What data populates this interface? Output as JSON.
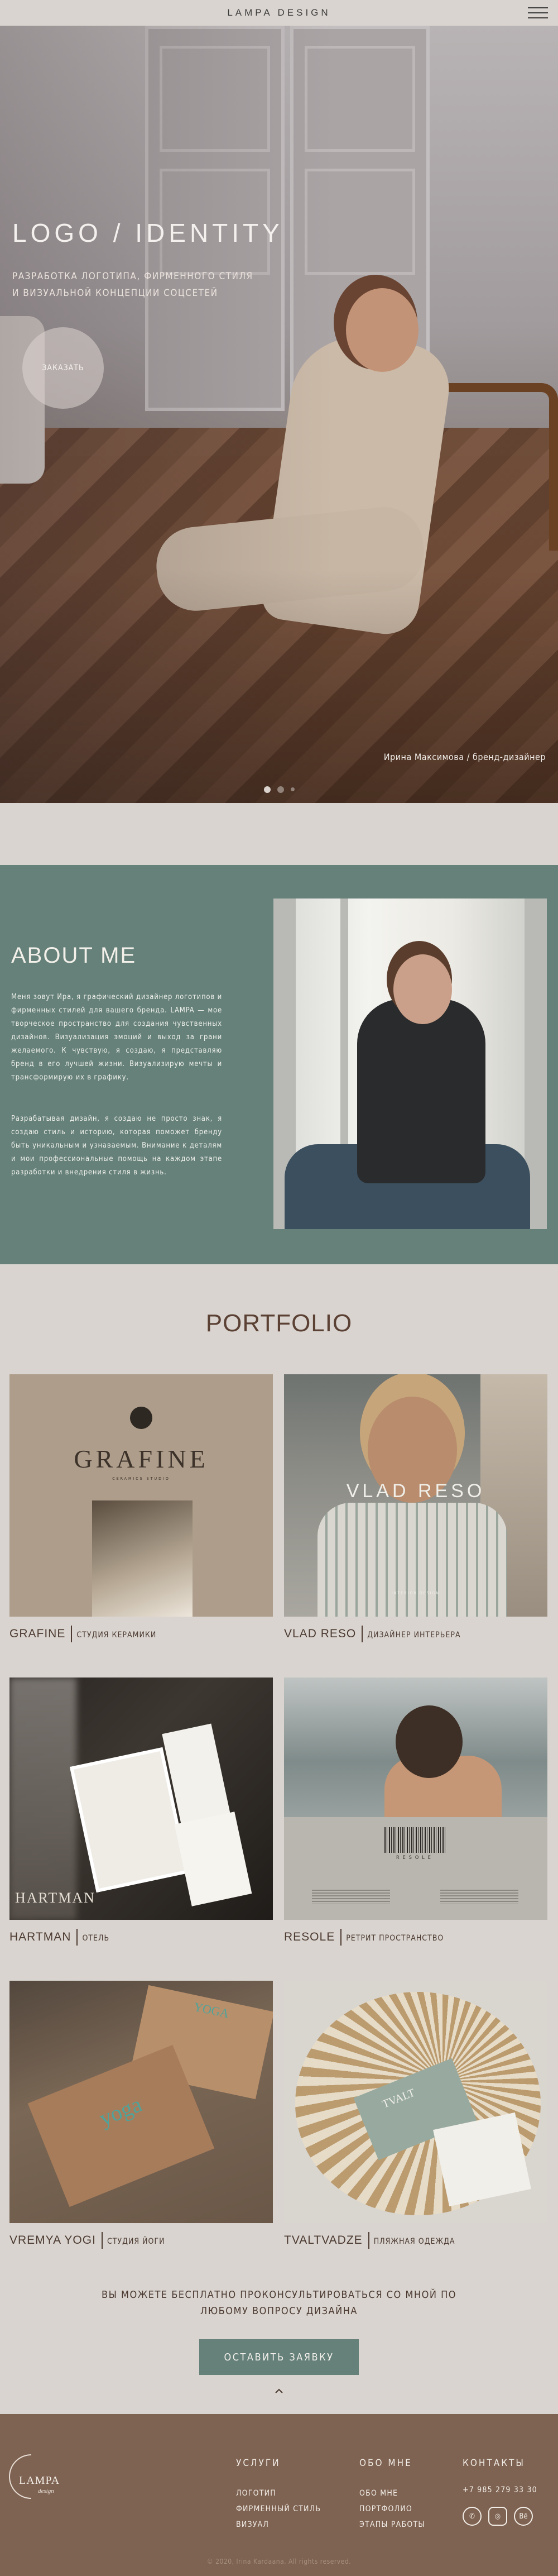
{
  "header": {
    "brand": "LAMPA DESIGN",
    "menu_icon": "burger-menu-icon"
  },
  "hero": {
    "title": "LOGO / IDENTITY",
    "subtitle_line1": "РАЗРАБОТКА ЛОГОТИПА, ФИРМЕННОГО СТИЛЯ",
    "subtitle_line2": "И ВИЗУАЛЬНОЙ КОНЦЕПЦИИ СОЦСЕТЕЙ",
    "cta": "ЗАКАЗАТЬ",
    "caption": "Ирина Максимова / бренд-дизайнер",
    "slides_total": 3,
    "slide_active": 1
  },
  "about": {
    "title": "ABOUT ME",
    "paragraph1": "Меня зовут Ира, я графический дизайнер логотипов и фирменных стилей для вашего бренда. LAMPA — мое творческое пространство для создания чувственных дизайнов. Визуализация эмоций и выход за грани желаемого. К чувствую, я создаю, я представляю бренд в его лучшей жизни. Визуализирую мечты и трансформирую их в графику.",
    "paragraph2": "Разрабатывая дизайн, я создаю не просто знак, я создаю стиль и историю, которая поможет бренду быть уникальным и узнаваемым. Внимание к деталям и мои профессиональные помощь на каждом этапе разработки и внедрения стиля в жизнь."
  },
  "portfolio": {
    "title": "PORTFOLIO",
    "items": [
      {
        "name": "GRAFINE",
        "desc": "СТУДИЯ КЕРАМИКИ",
        "img_text": "GRAFINE",
        "img_sub": "CERAMICS STUDIO"
      },
      {
        "name": "VLAD RESO",
        "desc": "ДИЗАЙНЕР ИНТЕРЬЕРА",
        "img_text": "VLAD RESO",
        "img_sub": "INTERIOR DESIGN"
      },
      {
        "name": "HARTMAN",
        "desc": "ОТЕЛЬ",
        "img_text": "HARTMAN"
      },
      {
        "name": "RESOLE",
        "desc": "РЕТРИТ ПРОСТРАНСТВО",
        "img_text": "RESOLE"
      },
      {
        "name": "VREMYA YOGI",
        "desc": "СТУДИЯ ЙОГИ",
        "img_text": "yoga",
        "img_sub": "YOGA"
      },
      {
        "name": "TVALTVADZE",
        "desc": "ПЛЯЖНАЯ ОДЕЖДА",
        "img_text": "TVALT"
      }
    ]
  },
  "consult": {
    "line1": "ВЫ МОЖЕТЕ БЕСПЛАТНО ПРОКОНСУЛЬТИРОВАТЬСЯ СО МНОЙ ПО",
    "line2": "ЛЮБОМУ ВОПРОСУ ДИЗАЙНА",
    "button": "ОСТАВИТЬ ЗАЯВКУ",
    "up_icon": "chevron-up-icon"
  },
  "footer": {
    "logo_text": "LAMPA",
    "logo_script": "design",
    "services": {
      "title": "УСЛУГИ",
      "items": [
        "ЛОГОТИП",
        "ФИРМЕННЫЙ СТИЛЬ",
        "ВИЗУАЛ"
      ]
    },
    "about": {
      "title": "ОБО МНЕ",
      "items": [
        "ОБО МНЕ",
        "ПОРТФОЛИО",
        "ЭТАПЫ РАБОТЫ"
      ]
    },
    "contacts": {
      "title": "КОНТАКТЫ",
      "phone": "+7 985 279 33 30",
      "socials": [
        "whatsapp-icon",
        "instagram-icon",
        "behance-icon"
      ]
    },
    "copyright": "© 2020, Irina Kardaana. All rights reserved."
  },
  "colors": {
    "background": "#d9d4cf",
    "accent": "#66807a",
    "footer": "#7e6352",
    "text": "#4c3a31"
  }
}
